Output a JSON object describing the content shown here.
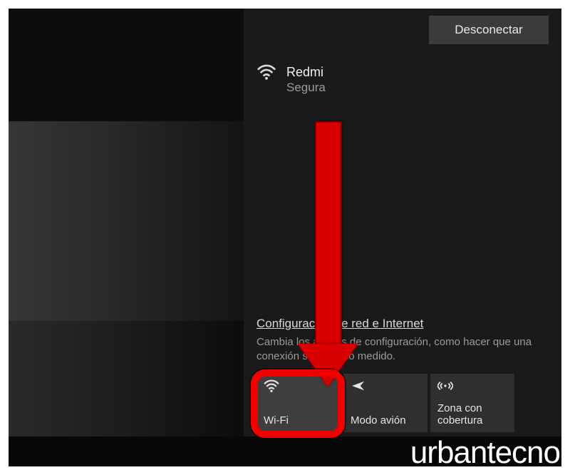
{
  "panel": {
    "disconnect_label": "Desconectar",
    "network": {
      "name": "Redmi",
      "status": "Segura"
    },
    "settings_link": "Configuración de red e Internet",
    "settings_desc": "Cambia los ajustes de configuración, como hacer que una conexión sea de uso medido."
  },
  "tiles": {
    "wifi": "Wi-Fi",
    "airplane": "Modo avión",
    "hotspot": "Zona con cobertura"
  },
  "icons": {
    "wifi": "wifi-icon",
    "airplane": "airplane-icon",
    "hotspot": "hotspot-icon"
  },
  "watermark": "urbantecno"
}
